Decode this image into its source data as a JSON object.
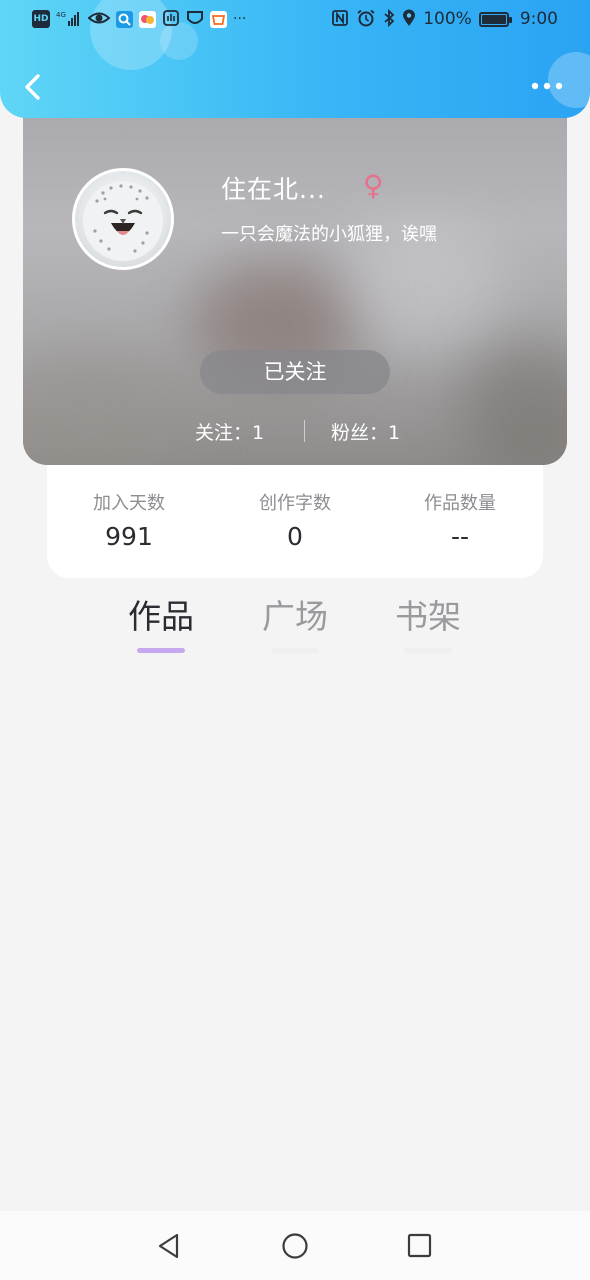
{
  "status_bar": {
    "left_icons": [
      "hd-icon",
      "4g-signal-icon",
      "eye-icon",
      "search-app-icon",
      "photo-app-icon",
      "hand-app-icon",
      "shield-app-icon",
      "shopping-app-icon"
    ],
    "more_indicator": "···",
    "right_icons": [
      "nfc-icon",
      "alarm-icon",
      "bluetooth-icon",
      "location-icon"
    ],
    "battery": "100%",
    "time": "9:00"
  },
  "header": {
    "colors": {
      "gradient_start": "#5fd6f6",
      "gradient_end": "#2aa3f3"
    }
  },
  "profile": {
    "nickname": "住在北...",
    "gender_symbol": "♀",
    "bio": "一只会魔法的小狐狸，诶嘿",
    "follow_button_label": "已关注",
    "following_label": "关注：1",
    "followers_label": "粉丝：1",
    "colors": {
      "gender": "#e7718a"
    }
  },
  "info": [
    {
      "label": "加入天数",
      "value": "991"
    },
    {
      "label": "创作字数",
      "value": "0"
    },
    {
      "label": "作品数量",
      "value": "--"
    }
  ],
  "tabs": [
    {
      "label": "作品",
      "active": true
    },
    {
      "label": "广场",
      "active": false
    },
    {
      "label": "书架",
      "active": false
    }
  ],
  "tab_indicator_color": "#c6a8ee",
  "nav_bar": [
    "back-triangle-icon",
    "home-circle-icon",
    "recent-square-icon"
  ]
}
